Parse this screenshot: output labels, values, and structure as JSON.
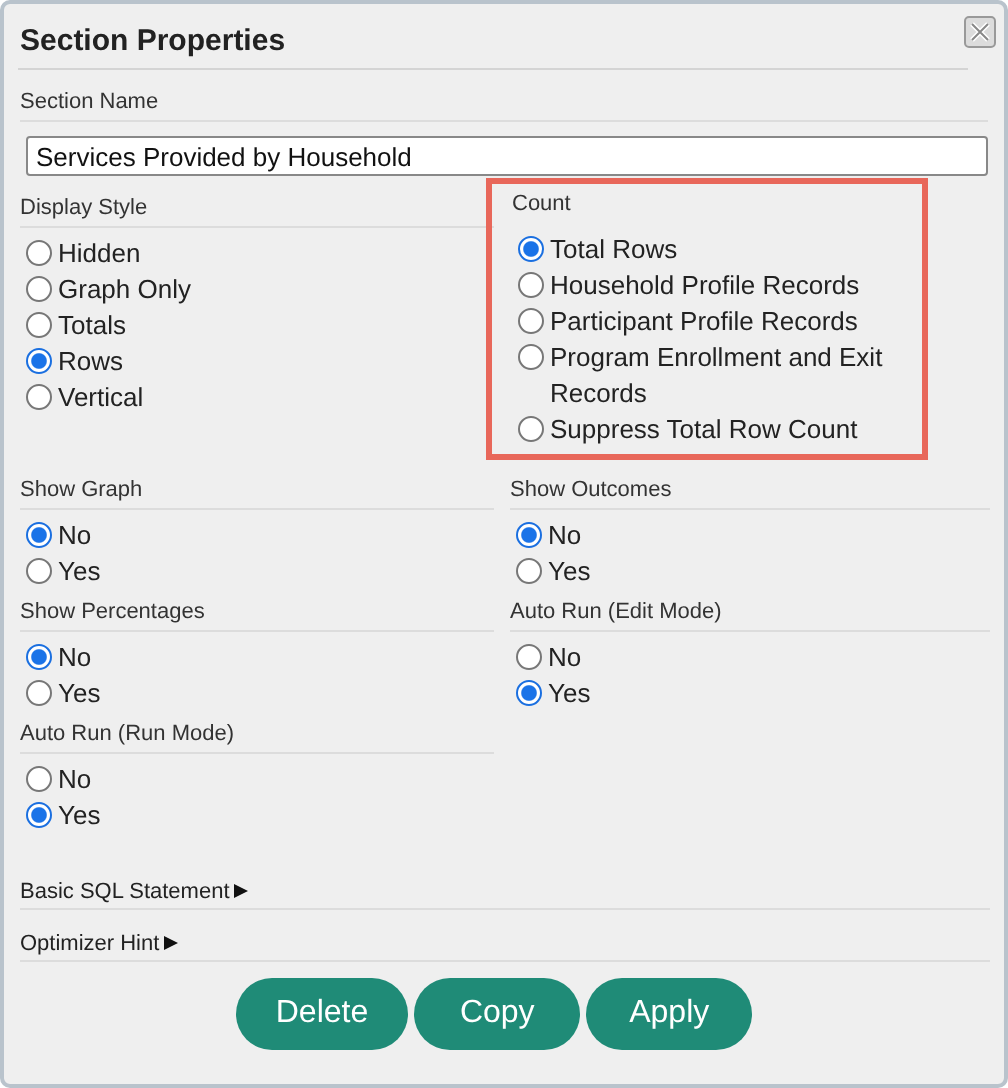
{
  "window": {
    "title": "Section Properties"
  },
  "section_name": {
    "label": "Section Name",
    "value": "Services Provided by Household"
  },
  "display_style": {
    "label": "Display Style",
    "options": [
      {
        "label": "Hidden",
        "selected": false
      },
      {
        "label": "Graph Only",
        "selected": false
      },
      {
        "label": "Totals",
        "selected": false
      },
      {
        "label": "Rows",
        "selected": true
      },
      {
        "label": "Vertical",
        "selected": false
      }
    ]
  },
  "count": {
    "label": "Count",
    "highlighted": true,
    "options": [
      {
        "label": "Total Rows",
        "selected": true
      },
      {
        "label": "Household Profile Records",
        "selected": false
      },
      {
        "label": "Participant Profile Records",
        "selected": false
      },
      {
        "label": "Program Enrollment and Exit Records",
        "selected": false
      },
      {
        "label": "Suppress Total Row Count",
        "selected": false
      }
    ]
  },
  "settings": [
    {
      "label": "Show Graph",
      "options": [
        {
          "label": "No",
          "selected": true
        },
        {
          "label": "Yes",
          "selected": false
        }
      ]
    },
    {
      "label": "Show Outcomes",
      "options": [
        {
          "label": "No",
          "selected": true
        },
        {
          "label": "Yes",
          "selected": false
        }
      ]
    },
    {
      "label": "Show Percentages",
      "options": [
        {
          "label": "No",
          "selected": true
        },
        {
          "label": "Yes",
          "selected": false
        }
      ]
    },
    {
      "label": "Auto Run (Edit Mode)",
      "options": [
        {
          "label": "No",
          "selected": false
        },
        {
          "label": "Yes",
          "selected": true
        }
      ]
    },
    {
      "label": "Auto Run (Run Mode)",
      "options": [
        {
          "label": "No",
          "selected": false
        },
        {
          "label": "Yes",
          "selected": true
        }
      ]
    }
  ],
  "expanders": [
    {
      "label": "Basic SQL Statement",
      "expanded": false
    },
    {
      "label": "Optimizer Hint",
      "expanded": false
    }
  ],
  "buttons": [
    "Delete",
    "Copy",
    "Apply"
  ]
}
